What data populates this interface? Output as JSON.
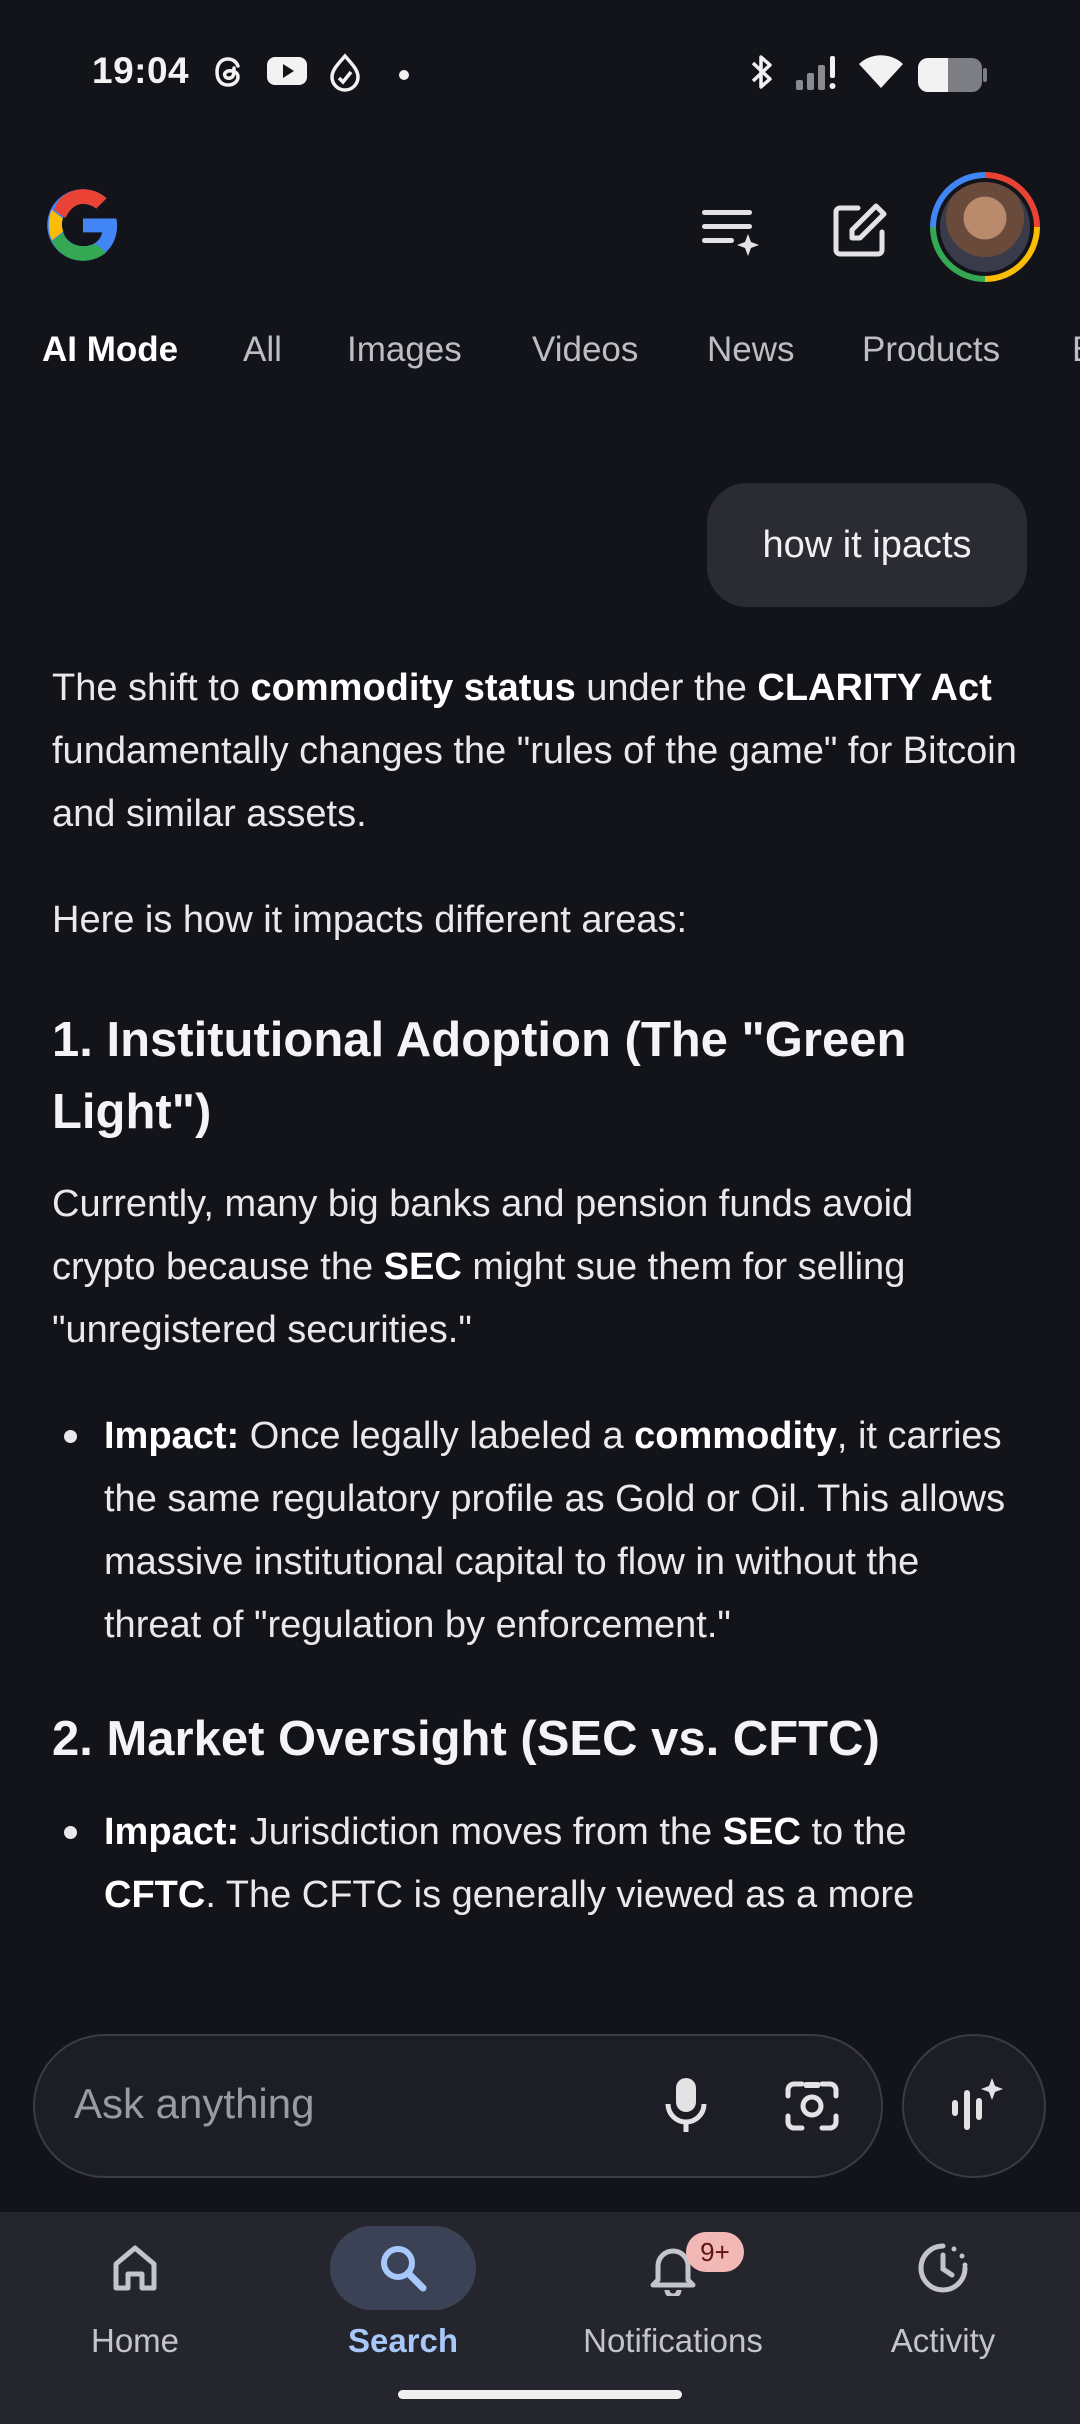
{
  "status_bar": {
    "time": "19:04",
    "icons": [
      "threads-icon",
      "youtube-icon",
      "fitbit-icon",
      "dot-icon",
      "bluetooth-icon",
      "signal-icon",
      "wifi-icon",
      "battery-icon"
    ]
  },
  "header": {
    "logo": "google-logo",
    "actions": [
      "history-icon",
      "new-chat-icon",
      "avatar"
    ]
  },
  "tabs": [
    {
      "label": "AI Mode",
      "active": true
    },
    {
      "label": "All"
    },
    {
      "label": "Images"
    },
    {
      "label": "Videos"
    },
    {
      "label": "News"
    },
    {
      "label": "Products"
    },
    {
      "label": "Books"
    }
  ],
  "query": "how it ipacts",
  "answer": {
    "intro": {
      "t1": "The shift to ",
      "b1": "commodity status",
      "t2": " under the ",
      "b2": "CLARITY Act",
      "t3": " fundamentally changes the \"rules of the game\" for Bitcoin and similar assets."
    },
    "lead": "Here is how it impacts different areas:",
    "section1": {
      "heading": "1. Institutional Adoption (The \"Green Light\")",
      "p_t1": "Currently, many big banks and pension funds avoid crypto because the ",
      "p_b1": "SEC",
      "p_t2": " might sue them for selling \"unregistered securities.\"",
      "bullet": {
        "label": "Impact:",
        "t1": " Once legally labeled a ",
        "b1": "commodity",
        "t2": ", it carries the same regulatory profile as Gold or Oil. This allows massive institutional capital to flow in without the threat of \"regulation by enforcement.\""
      }
    },
    "section2": {
      "heading": "2. Market Oversight (SEC vs. CFTC)",
      "bullet": {
        "label": "Impact:",
        "t1": " Jurisdiction moves from the ",
        "b1": "SEC",
        "t2": " to the ",
        "b2": "CFTC",
        "t3": ". The CFTC is generally viewed as a more"
      }
    }
  },
  "input": {
    "placeholder": "Ask anything",
    "icons": [
      "mic-icon",
      "lens-icon",
      "ai-mode-icon"
    ]
  },
  "bottom_nav": [
    {
      "label": "Home",
      "icon": "home-icon"
    },
    {
      "label": "Search",
      "icon": "search-icon",
      "active": true
    },
    {
      "label": "Notifications",
      "icon": "bell-icon",
      "badge": "9+"
    },
    {
      "label": "Activity",
      "icon": "activity-icon"
    }
  ],
  "colors": {
    "background": "#13141a",
    "active_nav": "#a8c7fa",
    "badge": "#f2b8b5"
  }
}
